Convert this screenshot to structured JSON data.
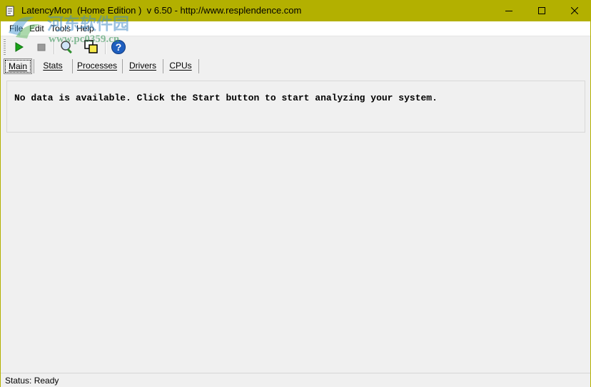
{
  "window": {
    "title": "LatencyMon  (Home Edition )  v 6.50 - http://www.resplendence.com"
  },
  "menu": {
    "items": [
      "File",
      "Edit",
      "Tools",
      "Help"
    ]
  },
  "toolbar": {
    "icons": [
      "start-play-icon",
      "stop-icon",
      "search-magnifier-icon",
      "copy-windows-icon",
      "help-icon"
    ]
  },
  "tabs": {
    "items": [
      "Main",
      "Stats",
      "Processes",
      "Drivers",
      "CPUs"
    ],
    "active": "Main"
  },
  "main": {
    "message": "No data is available. Click the Start button to start analyzing your system."
  },
  "status": {
    "text": "Status: Ready"
  },
  "watermark": {
    "line1": "河东软件园",
    "line2": "www.pc0359.cn"
  },
  "colors": {
    "titlebar": "#b3b000",
    "client_bg": "#f0f0f0",
    "help_blue": "#1f5fbf",
    "play_green": "#1aa31a"
  }
}
